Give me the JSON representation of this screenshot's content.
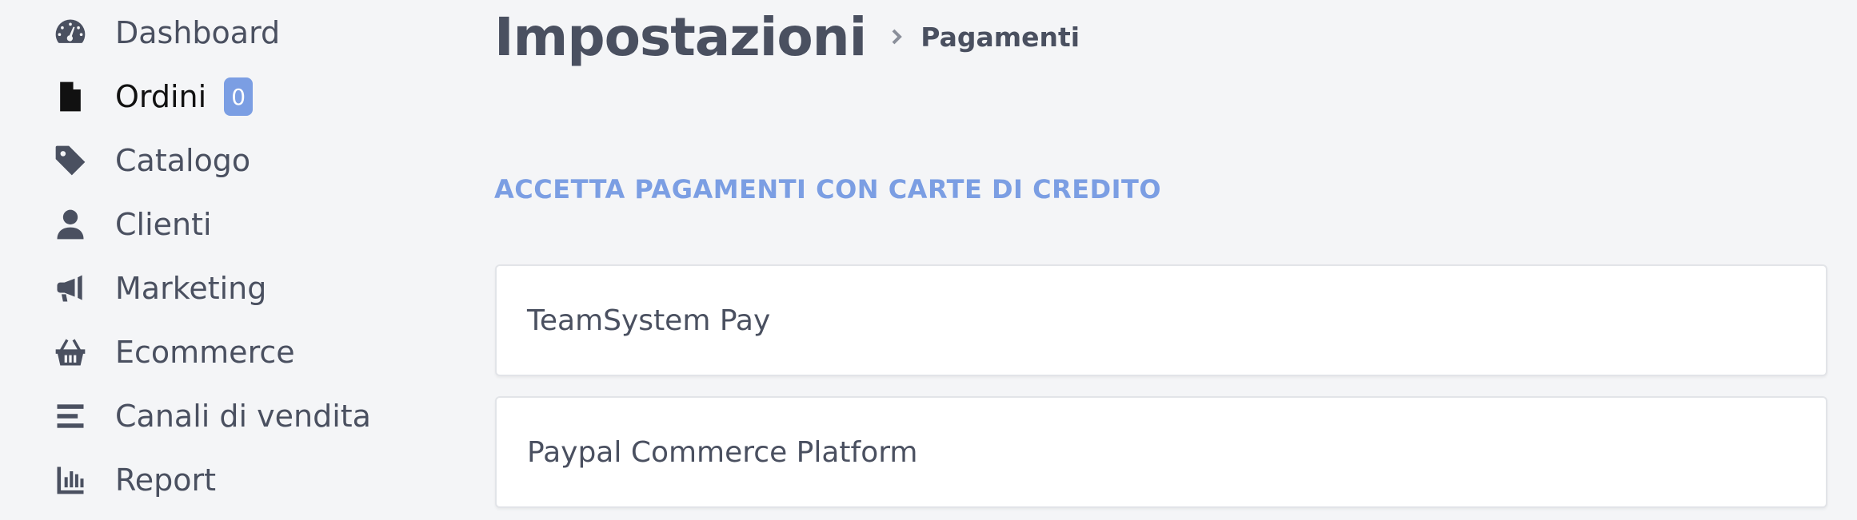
{
  "sidebar": {
    "items": [
      {
        "label": "Dashboard",
        "icon": "dashboard-icon"
      },
      {
        "label": "Ordini",
        "icon": "file-icon",
        "badge": "0"
      },
      {
        "label": "Catalogo",
        "icon": "tag-icon"
      },
      {
        "label": "Clienti",
        "icon": "user-icon"
      },
      {
        "label": "Marketing",
        "icon": "megaphone-icon"
      },
      {
        "label": "Ecommerce",
        "icon": "basket-icon"
      },
      {
        "label": "Canali di vendita",
        "icon": "bars-icon"
      },
      {
        "label": "Report",
        "icon": "chart-icon"
      }
    ]
  },
  "header": {
    "title": "Impostazioni",
    "breadcrumb": "Pagamenti"
  },
  "main": {
    "section_title": "ACCETTA PAGAMENTI CON CARTE DI CREDITO",
    "providers": [
      {
        "label": "TeamSystem Pay"
      },
      {
        "label": "Paypal Commerce Platform"
      }
    ]
  },
  "colors": {
    "accent": "#7b9ee3",
    "text": "#4a5060",
    "background": "#f4f5f7"
  }
}
